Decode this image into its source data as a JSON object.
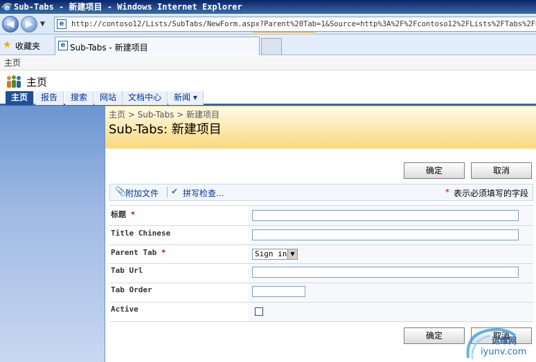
{
  "browser": {
    "window_title": "Sub-Tabs - 新建项目 - Windows Internet Explorer",
    "address": "http://contoso12/Lists/SubTabs/NewForm.aspx?Parent%20Tab=1&Source=http%3A%2F%2Fcontoso12%2FLists%2FTabs%2FDispFo",
    "favorites_label": "收藏夹",
    "tab_label": "Sub-Tabs - 新建项目"
  },
  "site": {
    "top_breadcrumb": "主页",
    "title": "主页",
    "nav": [
      "主页",
      "报告",
      "搜索",
      "网站",
      "文档中心",
      "新闻 ▾"
    ]
  },
  "page": {
    "breadcrumb": "主页 > Sub-Tabs > 新建项目",
    "title": "Sub-Tabs: 新建项目"
  },
  "toolbar": {
    "ok_label": "确定",
    "cancel_label": "取消",
    "attach_label": "附加文件",
    "spell_label": "拼写检查...",
    "required_note": "表示必须填写的字段"
  },
  "form": {
    "fields": [
      {
        "label": "标题",
        "required": true
      },
      {
        "label": "Title Chinese",
        "required": false
      },
      {
        "label": "Parent Tab",
        "required": true
      },
      {
        "label": "Tab Url",
        "required": false
      },
      {
        "label": "Tab Order",
        "required": false
      },
      {
        "label": "Active",
        "required": false
      }
    ],
    "parent_tab_value": "Sign in"
  },
  "watermark": {
    "line1": "运维网",
    "line2": "iyunv.com"
  }
}
